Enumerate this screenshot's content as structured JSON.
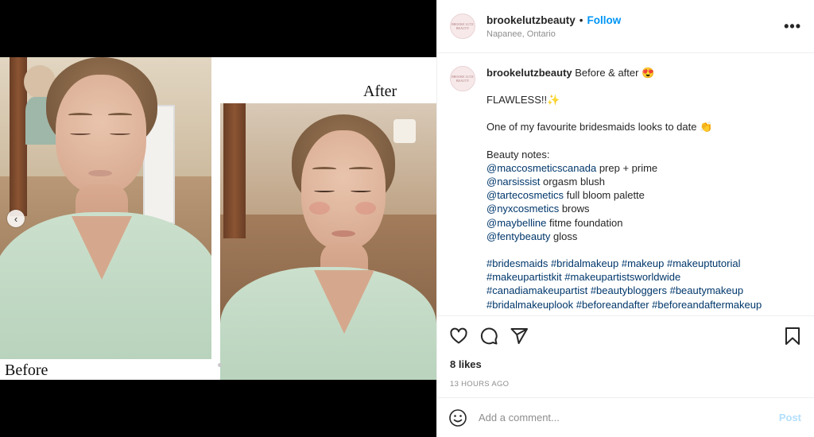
{
  "media": {
    "before_label": "Before",
    "after_label": "After",
    "prev_glyph": "‹"
  },
  "header": {
    "avatar_text": "BROOKE LUTZ BEAUTY",
    "username": "brookelutzbeauty",
    "separator": "•",
    "follow_label": "Follow",
    "location": "Napanee, Ontario",
    "more_glyph": "•••"
  },
  "caption": {
    "username": "brookelutzbeauty",
    "title": "Before & after",
    "title_emoji": "😍",
    "line_flawless": "FLAWLESS!!",
    "flawless_emoji": "✨",
    "line_favourite": "One of my favourite bridesmaids looks to date",
    "favourite_emoji": "👏",
    "beauty_notes": "Beauty notes:",
    "notes": [
      {
        "mention": "@maccosmeticscanada",
        "text": " prep + prime"
      },
      {
        "mention": "@narsissist",
        "text": " orgasm blush"
      },
      {
        "mention": "@tartecosmetics",
        "text": " full bloom palette"
      },
      {
        "mention": "@nyxcosmetics",
        "text": " brows"
      },
      {
        "mention": "@maybelline",
        "text": " fitme foundation"
      },
      {
        "mention": "@fentybeauty",
        "text": " gloss"
      }
    ],
    "hashtag_lines": [
      [
        "#bridesmaids",
        "#bridalmakeup",
        "#makeup",
        "#makeuptutorial"
      ],
      [
        "#makeupartistkit",
        "#makeupartistsworldwide"
      ],
      [
        "#canadiamakeupartist",
        "#beautybloggers",
        "#beautymakeup"
      ],
      [
        "#bridalmakeuplook",
        "#beforeandafter",
        "#beforeandaftermakeup"
      ]
    ]
  },
  "actions": {
    "icons": [
      "heart-icon",
      "comment-icon",
      "share-icon",
      "bookmark-icon"
    ],
    "likes": "8 likes",
    "timestamp": "13 HOURS AGO"
  },
  "comment": {
    "placeholder": "Add a comment...",
    "post_label": "Post"
  },
  "colors": {
    "accent": "#0095f6",
    "link": "#00376b",
    "muted": "#8e8e8e",
    "post_disabled": "#b2dffc"
  }
}
